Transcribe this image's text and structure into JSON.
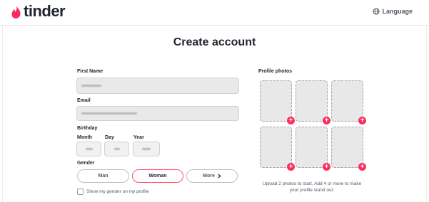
{
  "header": {
    "logo_text": "tinder",
    "language_label": "Language"
  },
  "title": "Create account",
  "form": {
    "first_name_label": "First Name",
    "email_label": "Email",
    "birthday_label": "Birthday",
    "month_label": "Month",
    "day_label": "Day",
    "year_label": "Year",
    "gender_label": "Gender",
    "gender_options": [
      "Man",
      "Woman",
      "More"
    ],
    "selected_gender": "Woman",
    "show_gender_label": "Show my gender on my profile"
  },
  "photos": {
    "label": "Profile photos",
    "slot_count": 6,
    "note": "Upload 2 photos to start. Add 4 or more to make your profile stand out."
  },
  "colors": {
    "brand": "#fd2b5f",
    "selected_border": "#fd5068"
  },
  "icons": {
    "logo": "flame-icon",
    "language": "globe-icon",
    "more": "chevron-right-icon",
    "add_photo": "plus-icon"
  }
}
